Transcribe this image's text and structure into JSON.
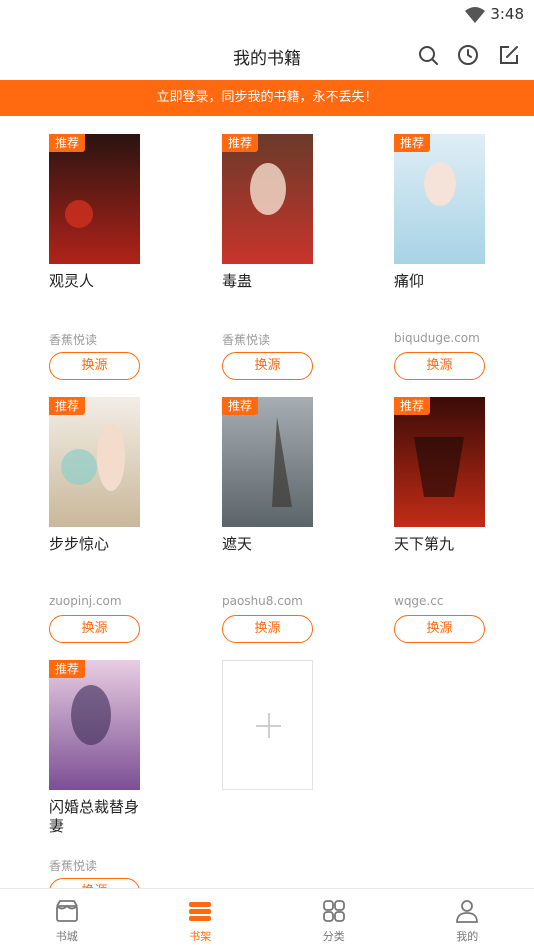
{
  "status": {
    "time": "3:48"
  },
  "header": {
    "title": "我的书籍"
  },
  "banner": {
    "text": "立即登录，同步我的书籍，永不丢失！"
  },
  "badge": "推荐",
  "swap_label": "换源",
  "books": [
    {
      "title": "观灵人",
      "source": "香蕉悦读",
      "cover_colors": [
        "#2a1410",
        "#b0231a"
      ]
    },
    {
      "title": "毒蛊",
      "source": "香蕉悦读",
      "cover_colors": [
        "#6a3a2a",
        "#c8342c"
      ]
    },
    {
      "title": "痛仰",
      "source": "biquduge.com",
      "cover_colors": [
        "#dfeef5",
        "#a8d3e6"
      ]
    },
    {
      "title": "步步惊心",
      "source": "zuopinj.com",
      "cover_colors": [
        "#f2eee6",
        "#c9b89a"
      ]
    },
    {
      "title": "遮天",
      "source": "paoshu8.com",
      "cover_colors": [
        "#a7aeb3",
        "#5b6468"
      ]
    },
    {
      "title": "天下第九",
      "source": "wqge.cc",
      "cover_colors": [
        "#3a0b08",
        "#c22c16"
      ]
    },
    {
      "title": "闪婚总裁替身妻",
      "source": "香蕉悦读",
      "cover_colors": [
        "#e8cde2",
        "#7b4f93"
      ]
    }
  ],
  "tabs": [
    {
      "label": "书城",
      "icon": "store-icon",
      "active": false
    },
    {
      "label": "书架",
      "icon": "bookshelf-icon",
      "active": true
    },
    {
      "label": "分类",
      "icon": "category-icon",
      "active": false
    },
    {
      "label": "我的",
      "icon": "profile-icon",
      "active": false
    }
  ],
  "colors": {
    "accent": "#ff6a10"
  }
}
